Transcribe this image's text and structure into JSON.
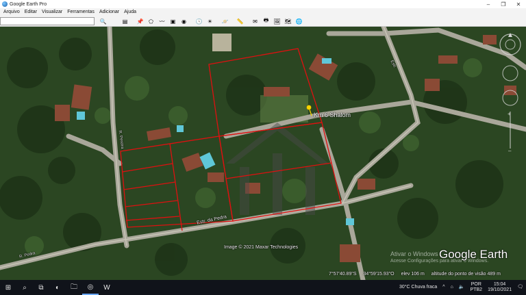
{
  "window": {
    "title": "Google Earth Pro",
    "minimize": "–",
    "maximize": "❐",
    "close": "✕"
  },
  "menu": [
    "Arquivo",
    "Editar",
    "Visualizar",
    "Ferramentas",
    "Adicionar",
    "Ajuda"
  ],
  "search": {
    "value": "",
    "placeholder": ""
  },
  "map": {
    "placemark": "Km 6 Shalom",
    "roads": {
      "main": "Estr. da Pedra",
      "side": "R. Pereira",
      "east": "Estr.",
      "southwest": "R. Pedra"
    },
    "copyright": "Image © 2021 Maxar Technologies",
    "brand": "Google Earth",
    "activate_title": "Ativar o Windows",
    "activate_sub": "Acesse Configurações para ativar o Windows.",
    "status": {
      "lat": "7°57'40.89\"S",
      "lon": "34°59'15.93\"O",
      "elev": "elev 106 m",
      "eye": "altitude do ponto de visão 489 m"
    },
    "colors": {
      "parcel": "#e01010",
      "placemark": "#f5d300"
    }
  },
  "taskbar": {
    "weather": "30°C  Chuva fraca",
    "lang1": "POR",
    "lang2": "PTB2",
    "time": "15:04",
    "date": "19/10/2021"
  }
}
